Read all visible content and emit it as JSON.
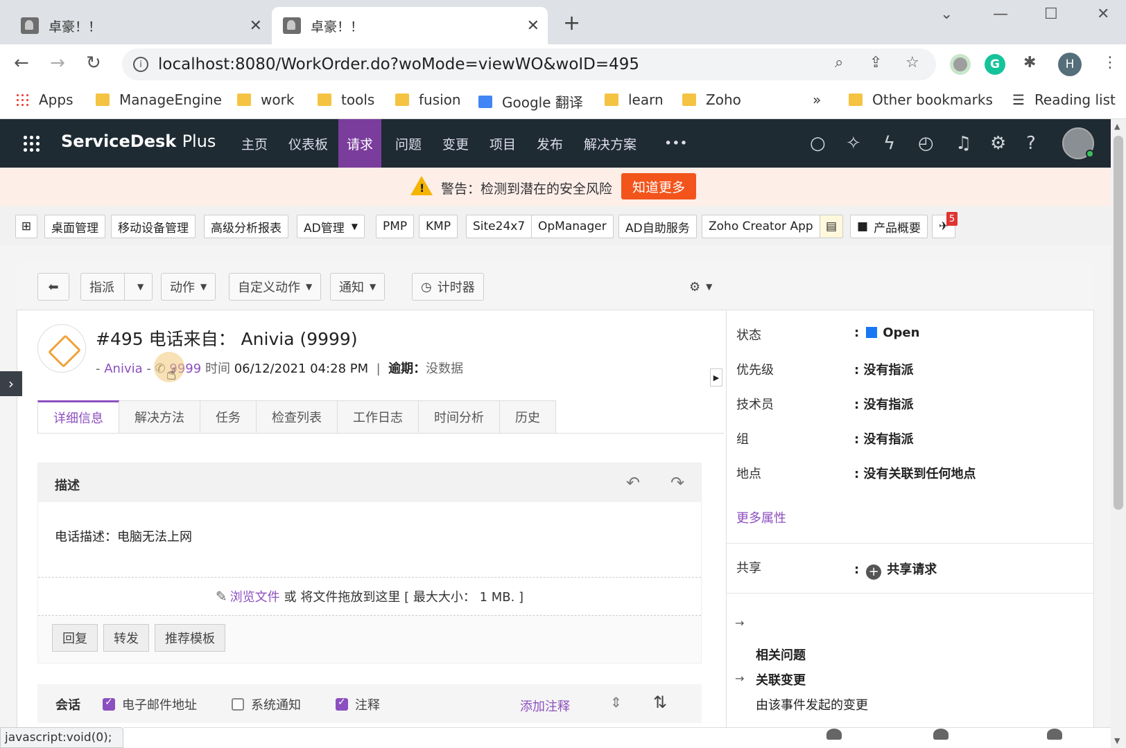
{
  "browser": {
    "tabs": [
      {
        "title": "卓豪！！",
        "active": false
      },
      {
        "title": "卓豪！！",
        "active": true
      }
    ],
    "url": "localhost:8080/WorkOrder.do?woMode=viewWO&woID=495",
    "profile_initial": "H",
    "bookmarks": [
      "Apps",
      "ManageEngine",
      "work",
      "tools",
      "fusion",
      "Google 翻译",
      "learn",
      "Zoho"
    ],
    "overflow": "»",
    "other_bookmarks": "Other bookmarks",
    "reading_list": "Reading list"
  },
  "app": {
    "brand": "ServiceDesk",
    "brand_suffix": "Plus",
    "nav": [
      "主页",
      "仪表板",
      "请求",
      "问题",
      "变更",
      "项目",
      "发布",
      "解决方案"
    ],
    "nav_active": "请求",
    "more": "•••"
  },
  "warning": {
    "message": "警告：检测到潜在的安全风险",
    "button": "知道更多"
  },
  "quicklinks": {
    "items": [
      "桌面管理",
      "移动设备管理",
      "高级分析报表",
      "AD管理",
      "PMP",
      "KMP",
      "Site24x7",
      "OpManager",
      "AD自助服务",
      "Zoho Creator App"
    ],
    "product_overview": "产品概要",
    "badge_count": "5"
  },
  "actions": {
    "assign": "指派",
    "action": "动作",
    "custom_action": "自定义动作",
    "notify": "通知",
    "timer": "计时器"
  },
  "request": {
    "title": "#495 电话来自：  Anivia (9999)",
    "requester": "Anivia",
    "phone": "9999",
    "time_label": "时间",
    "time_value": "06/12/2021 04:28 PM",
    "due_label": "逾期：",
    "due_value": "没数据"
  },
  "detail_tabs": [
    "详细信息",
    "解决方法",
    "任务",
    "检查列表",
    "工作日志",
    "时间分析",
    "历史"
  ],
  "description": {
    "header": "描述",
    "body": "电话描述：电脑无法上网",
    "attach_link": "浏览文件",
    "attach_text": "或 将文件拖放到这里 [ 最大大小：  1 MB. ]",
    "buttons": [
      "回复",
      "转发",
      "推荐模板"
    ]
  },
  "conversation": {
    "label": "会话",
    "filters": [
      {
        "label": "电子邮件地址",
        "checked": true
      },
      {
        "label": "系统通知",
        "checked": false
      },
      {
        "label": "注释",
        "checked": true
      }
    ],
    "add_note": "添加注释"
  },
  "properties": {
    "status_label": "状态",
    "status_value": "Open",
    "status_color": "#1877f2",
    "priority_label": "优先级",
    "priority_value": "没有指派",
    "technician_label": "技术员",
    "technician_value": "没有指派",
    "group_label": "组",
    "group_value": "没有指派",
    "site_label": "地点",
    "site_value": "没有关联到任何地点",
    "more": "更多属性",
    "share_label": "共享",
    "share_value": "共享请求",
    "related_problem": "相关问题",
    "related_change": "关联变更",
    "change_initiated": "由该事件发起的变更"
  },
  "statusbar": "javascript:void(0);",
  "bottom_icons": [
    "chat-icon",
    "technician-icon",
    "group-icon"
  ],
  "colors": {
    "accent": "#8c4fbf",
    "header": "#1f2b33",
    "warning_button": "#f2541b",
    "nav_active": "#7a3d9c"
  }
}
